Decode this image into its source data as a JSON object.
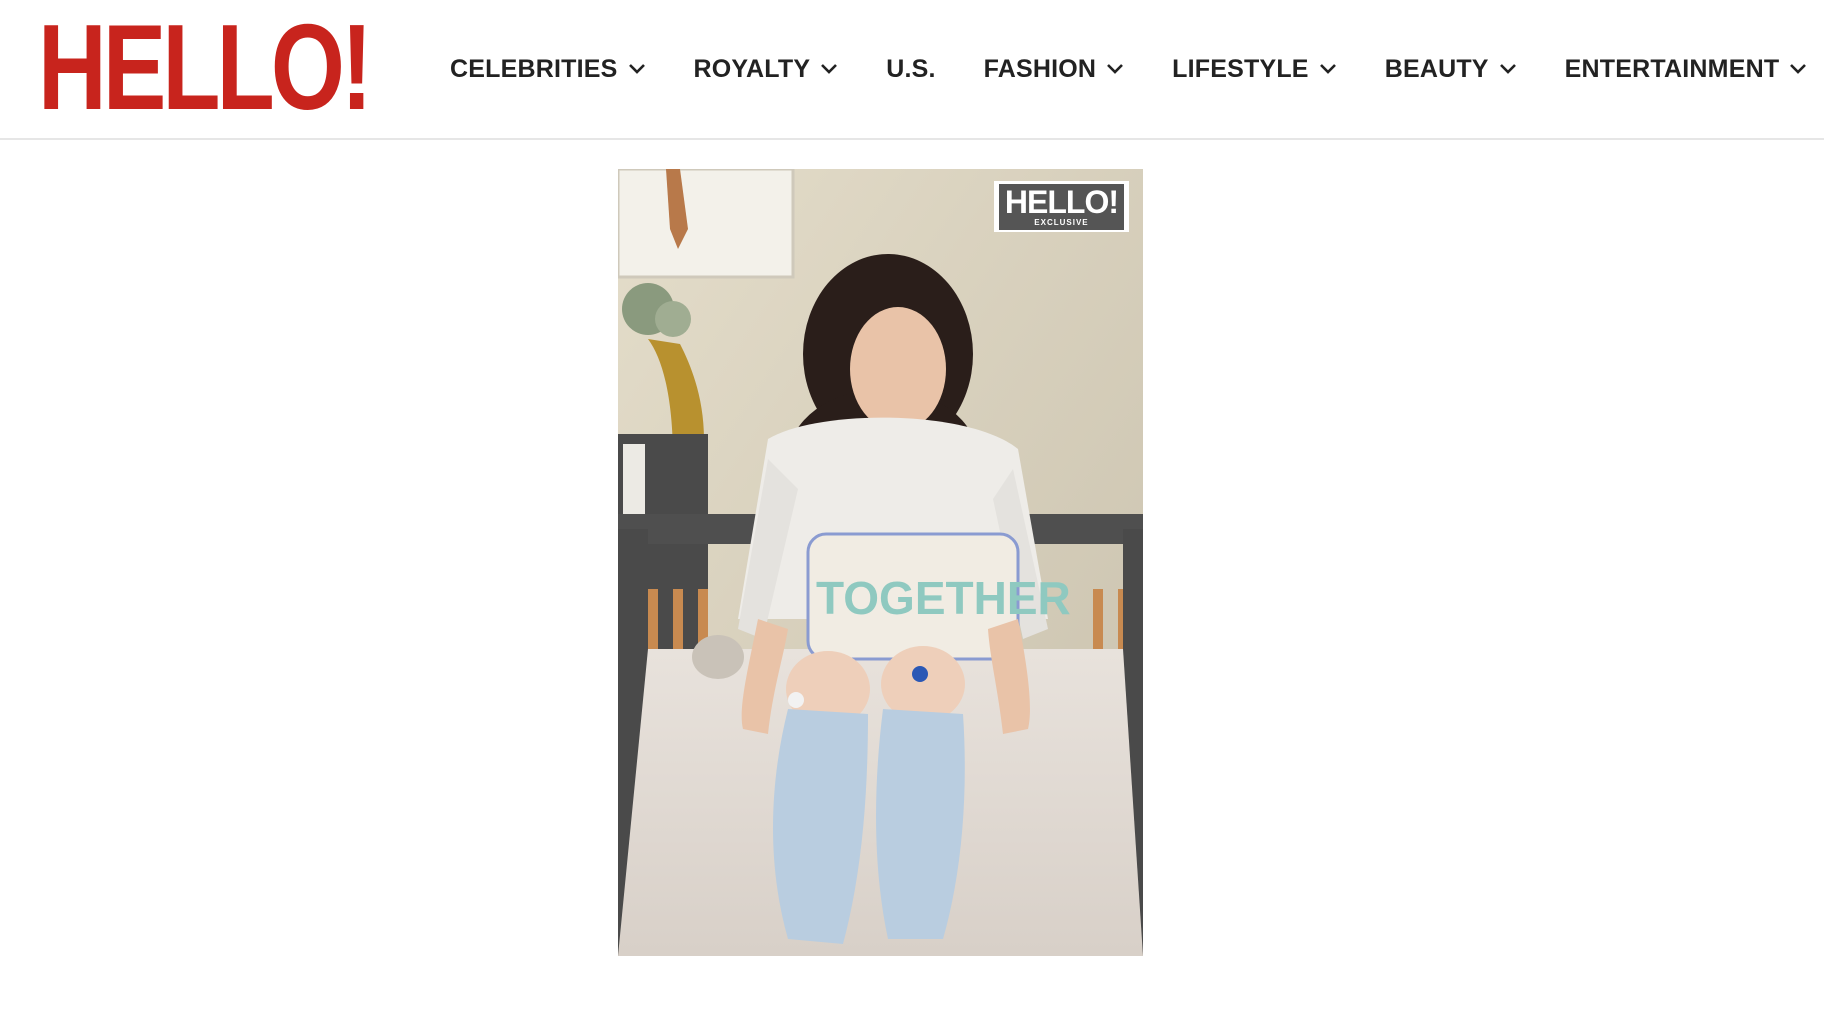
{
  "brand": {
    "logo_text": "HELLO!",
    "color": "#c8241d"
  },
  "nav": {
    "items": [
      {
        "label": "CELEBRITIES",
        "has_dropdown": true
      },
      {
        "label": "ROYALTY",
        "has_dropdown": true
      },
      {
        "label": "U.S.",
        "has_dropdown": false
      },
      {
        "label": "FASHION",
        "has_dropdown": true
      },
      {
        "label": "LIFESTYLE",
        "has_dropdown": true
      },
      {
        "label": "BEAUTY",
        "has_dropdown": true
      },
      {
        "label": "ENTERTAINMENT",
        "has_dropdown": true
      }
    ]
  },
  "photo": {
    "watermark_title": "HELLO!",
    "watermark_subtitle": "EXCLUSIVE",
    "pillow_text": "TOGETHER"
  }
}
